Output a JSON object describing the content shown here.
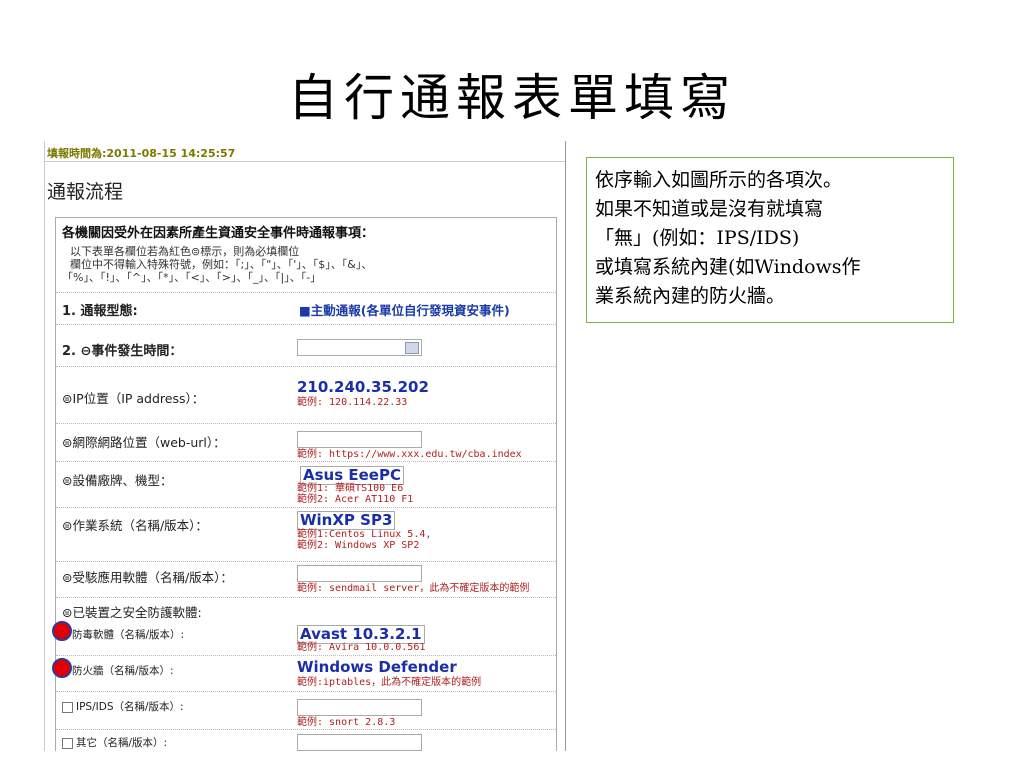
{
  "slide": {
    "title": "自行通報表單填寫"
  },
  "form": {
    "fill_time": "填報時間為:2011-08-15 14:25:57",
    "section_heading": "通報流程",
    "notice": {
      "title": "各機關因受外在因素所產生資通安全事件時通報事項：",
      "line1": "以下表單各欄位若為紅色⊜標示，則為必填欄位",
      "line2": "欄位中不得輸入特殊符號，例如：「;」、「\"」、「'」、「$」、「&」、",
      "line3": "「%」、「!」、「^」、「*」、「<」、「>」、「_」、「|」、「-」"
    },
    "report_type": {
      "label": "1. 通報型態:",
      "value": "■主動通報(各單位自行發現資安事件)"
    },
    "event_time": {
      "label": "2. ⊖事件發生時間："
    },
    "ip": {
      "label": "⊜IP位置（IP address）：",
      "value": "210.240.35.202",
      "example": "範例: 120.114.22.33"
    },
    "web_url": {
      "label": "⊜網際網路位置（web-url）：",
      "example": "範例: https://www.xxx.edu.tw/cba.index"
    },
    "device": {
      "label": "⊜設備廠牌、機型：",
      "value": "Asus EeePC",
      "example1": "範例1: 華碩TS100 E6",
      "example2": "範例2: Acer AT110 F1"
    },
    "os": {
      "label": "⊜作業系統（名稱/版本）：",
      "value": "WinXP SP3",
      "example1": "範例1:Centos Linux 5.4,",
      "example2": "範例2: Windows XP SP2"
    },
    "app": {
      "label": "⊜受駭應用軟體（名稱/版本）：",
      "example": "範例: sendmail server，此為不確定版本的範例"
    },
    "security_sw": {
      "label": "⊜已裝置之安全防護軟體:"
    },
    "antivirus": {
      "label": "防毒軟體（名稱/版本）:",
      "value": "Avast 10.3.2.1",
      "example": "範例: Avira 10.0.0.561"
    },
    "firewall": {
      "label": "防火牆（名稱/版本）:",
      "value": "Windows Defender",
      "example": "範例:iptables，此為不確定版本的範例"
    },
    "ips": {
      "label": "IPS/IDS（名稱/版本）:",
      "example": "範例: snort 2.8.3"
    },
    "other": {
      "label": "其它（名稱/版本）:"
    }
  },
  "note": {
    "line1": "依序輸入如圖所示的各項次。",
    "line2": "如果不知道或是沒有就填寫",
    "line3": "「無」(例如：IPS/IDS)",
    "line4": "或填寫系統內建(如Windows作",
    "line5": "業系統內建的防火牆。"
  },
  "colors": {
    "value_text": "#1a2ea8",
    "example_text": "#b02020",
    "note_border": "#7cb342",
    "marker": "#e00000"
  }
}
